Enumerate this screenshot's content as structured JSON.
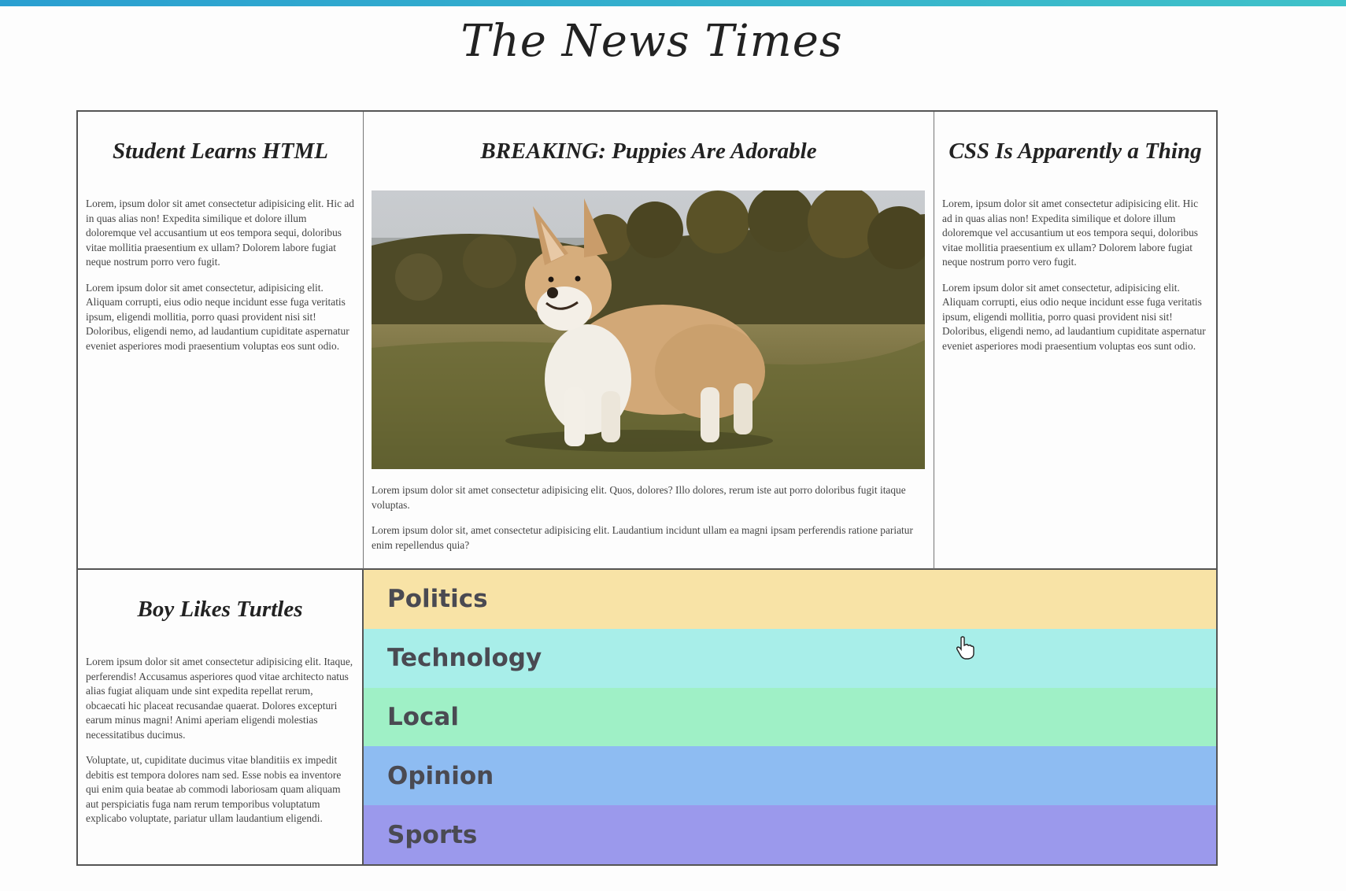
{
  "masthead": "The News Times",
  "articles": {
    "left_top": {
      "headline": "Student Learns HTML",
      "paragraphs": [
        "Lorem, ipsum dolor sit amet consectetur adipisicing elit. Hic ad in quas alias non! Expedita similique et dolore illum doloremque vel accusantium ut eos tempora sequi, doloribus vitae mollitia praesentium ex ullam? Dolorem labore fugiat neque nostrum porro vero fugit.",
        "Lorem ipsum dolor sit amet consectetur, adipisicing elit. Aliquam corrupti, eius odio neque incidunt esse fuga veritatis ipsum, eligendi mollitia, porro quasi provident nisi sit! Doloribus, eligendi nemo, ad laudantium cupiditate aspernatur eveniet asperiores modi praesentium voluptas eos sunt odio."
      ]
    },
    "center": {
      "headline": "BREAKING: Puppies Are Adorable",
      "paragraphs": [
        "Lorem ipsum dolor sit amet consectetur adipisicing elit. Quos, dolores? Illo dolores, rerum iste aut porro doloribus fugit itaque voluptas.",
        "Lorem ipsum dolor sit, amet consectetur adipisicing elit. Laudantium incidunt ullam ea magni ipsam perferendis ratione pariatur enim repellendus quia?"
      ]
    },
    "right_top": {
      "headline": "CSS Is Apparently a Thing",
      "paragraphs": [
        "Lorem, ipsum dolor sit amet consectetur adipisicing elit. Hic ad in quas alias non! Expedita similique et dolore illum doloremque vel accusantium ut eos tempora sequi, doloribus vitae mollitia praesentium ex ullam? Dolorem labore fugiat neque nostrum porro vero fugit.",
        "Lorem ipsum dolor sit amet consectetur, adipisicing elit. Aliquam corrupti, eius odio neque incidunt esse fuga veritatis ipsum, eligendi mollitia, porro quasi provident nisi sit! Doloribus, eligendi nemo, ad laudantium cupiditate aspernatur eveniet asperiores modi praesentium voluptas eos sunt odio."
      ]
    },
    "left_bottom": {
      "headline": "Boy Likes Turtles",
      "paragraphs": [
        "Lorem ipsum dolor sit amet consectetur adipisicing elit. Itaque, perferendis! Accusamus asperiores quod vitae architecto natus alias fugiat aliquam unde sint expedita repellat rerum, obcaecati hic placeat recusandae quaerat. Dolores excepturi earum minus magni! Animi aperiam eligendi molestias necessitatibus ducimus.",
        "Voluptate, ut, cupiditate ducimus vitae blanditiis ex impedit debitis est tempora dolores nam sed. Esse nobis ea inventore qui enim quia beatae ab commodi laboriosam quam aliquam aut perspiciatis fuga nam rerum temporibus voluptatum explicabo voluptate, pariatur ullam laudantium eligendi."
      ]
    }
  },
  "sections": [
    {
      "label": "Politics",
      "color": "#f8e3a6"
    },
    {
      "label": "Technology",
      "color": "#a8eee9"
    },
    {
      "label": "Local",
      "color": "#9ff0c6"
    },
    {
      "label": "Opinion",
      "color": "#8ebcf2"
    },
    {
      "label": "Sports",
      "color": "#9b99ec"
    }
  ],
  "colors": {
    "top_bar": "#2a9fd1",
    "border": "#555555"
  }
}
